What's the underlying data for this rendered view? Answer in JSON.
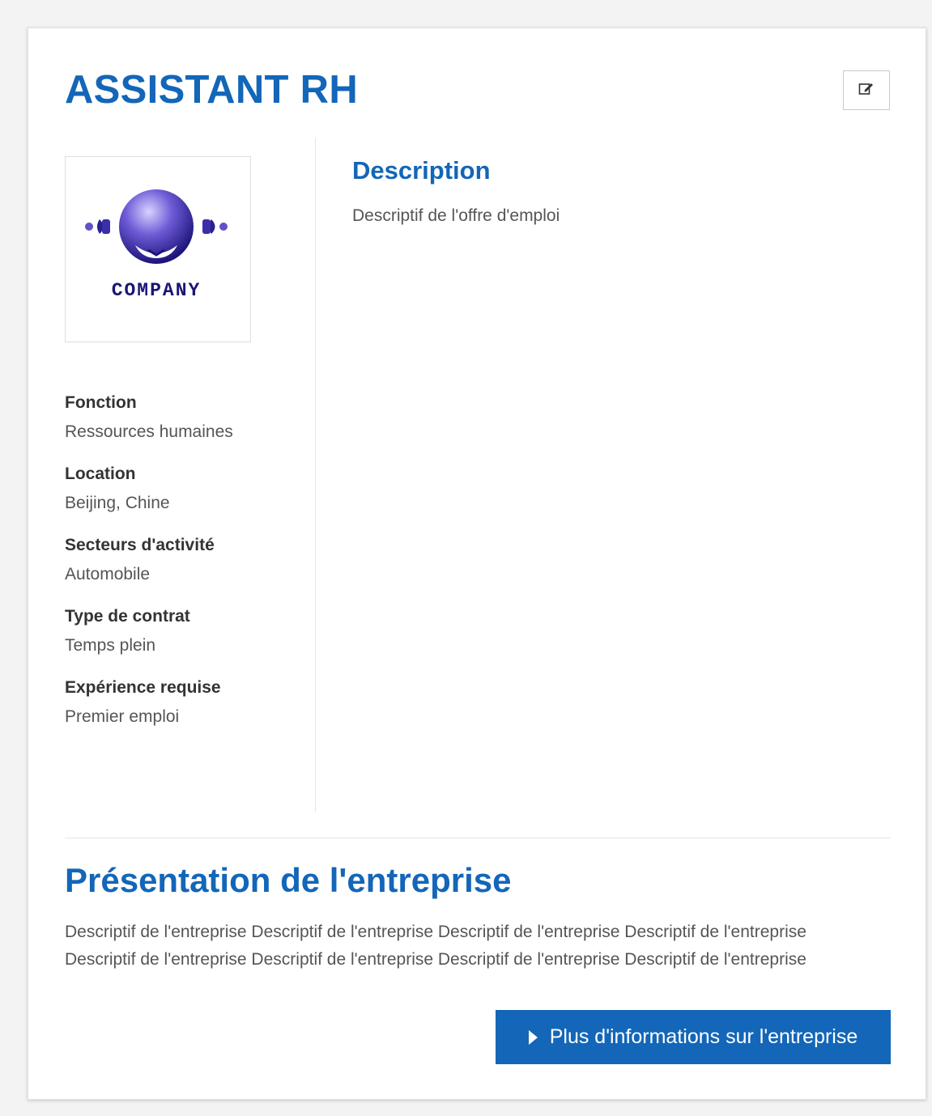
{
  "job": {
    "title": "ASSISTANT RH"
  },
  "edit": {
    "icon": "edit-icon"
  },
  "logo": {
    "text": "COMPANY",
    "icon": "company-logo"
  },
  "details": [
    {
      "label": "Fonction",
      "value": "Ressources humaines"
    },
    {
      "label": "Location",
      "value": "Beijing, Chine"
    },
    {
      "label": "Secteurs d'activité",
      "value": "Automobile"
    },
    {
      "label": "Type de contrat",
      "value": "Temps plein"
    },
    {
      "label": "Expérience requise",
      "value": "Premier emploi"
    }
  ],
  "description": {
    "heading": "Description",
    "text": "Descriptif de l'offre d'emploi"
  },
  "company": {
    "heading": "Présentation de l'entreprise",
    "text_lines": [
      "Descriptif de l'entreprise Descriptif de l'entreprise Descriptif de l'entreprise Descriptif de l'entreprise",
      "Descriptif de l'entreprise Descriptif de l'entreprise Descriptif de l'entreprise Descriptif de l'entreprise"
    ],
    "more_button_label": "Plus d'informations sur l'entreprise",
    "more_button_icon": "caret-right-icon"
  },
  "colors": {
    "accent": "#1366b8",
    "text": "#555555",
    "label": "#333333"
  }
}
